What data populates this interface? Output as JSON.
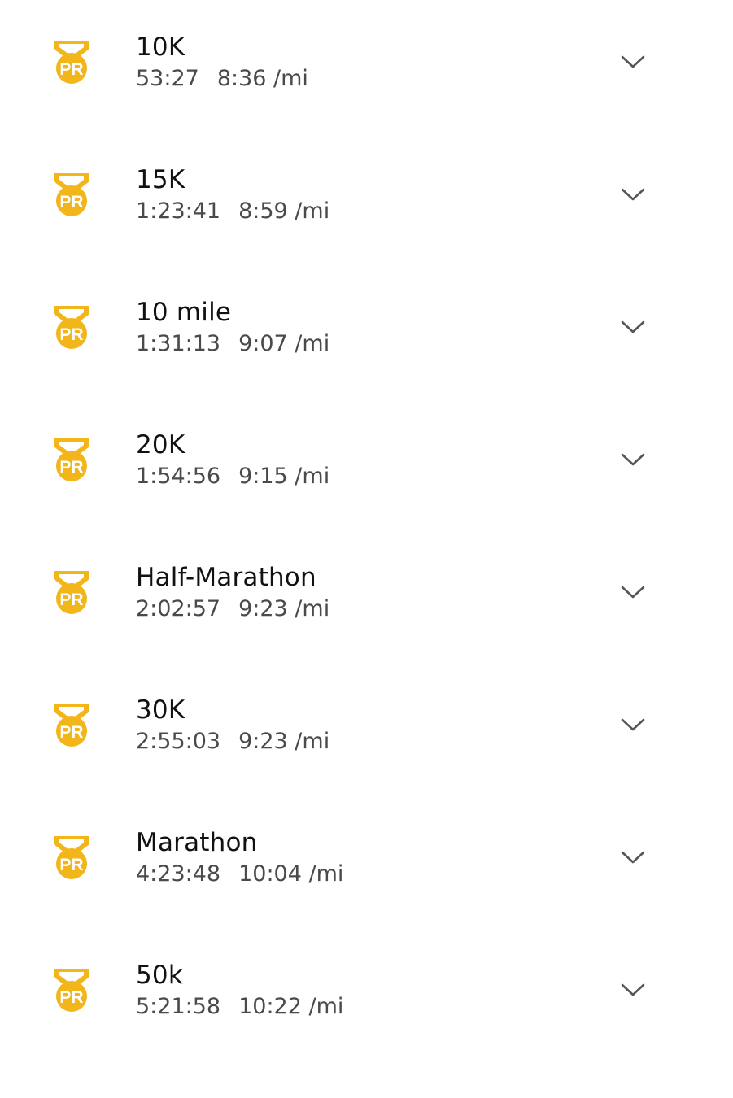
{
  "colors": {
    "badge": "#F2B51A",
    "title_text": "#111111",
    "stats_text": "#4a4a4a",
    "chevron": "#555555"
  },
  "badge": {
    "label": "PR",
    "icon": "pr-medal-icon"
  },
  "records": [
    {
      "distance": "10K",
      "time": "53:27",
      "pace": "8:36 /mi"
    },
    {
      "distance": "15K",
      "time": "1:23:41",
      "pace": "8:59 /mi"
    },
    {
      "distance": "10 mile",
      "time": "1:31:13",
      "pace": "9:07 /mi"
    },
    {
      "distance": "20K",
      "time": "1:54:56",
      "pace": "9:15 /mi"
    },
    {
      "distance": "Half-Marathon",
      "time": "2:02:57",
      "pace": "9:23 /mi"
    },
    {
      "distance": "30K",
      "time": "2:55:03",
      "pace": "9:23 /mi"
    },
    {
      "distance": "Marathon",
      "time": "4:23:48",
      "pace": "10:04 /mi"
    },
    {
      "distance": "50k",
      "time": "5:21:58",
      "pace": "10:22 /mi"
    }
  ]
}
